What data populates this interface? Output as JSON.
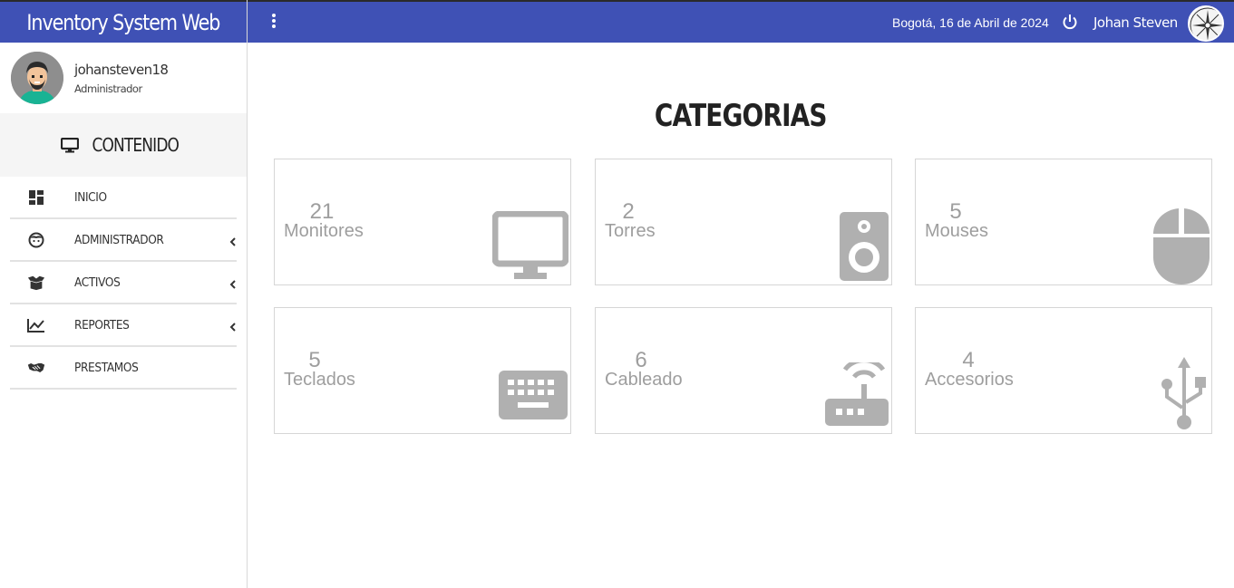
{
  "app": {
    "title": "Inventory System Web"
  },
  "topbar": {
    "date": "Bogotá, 16 de Abril de 2024",
    "user_name": "Johan Steven",
    "power_icon": "power-icon",
    "menu_icon": "kebab-menu-icon"
  },
  "sidebar": {
    "user": {
      "username": "johansteven18",
      "role": "Administrador"
    },
    "section_label": "CONTENIDO",
    "section_icon": "monitor-icon",
    "items": [
      {
        "label": "INICIO",
        "icon": "dashboard-icon",
        "has_submenu": false
      },
      {
        "label": "ADMINISTRADOR",
        "icon": "face-icon",
        "has_submenu": true
      },
      {
        "label": "ACTIVOS",
        "icon": "box-icon",
        "has_submenu": true
      },
      {
        "label": "REPORTES",
        "icon": "chart-line-icon",
        "has_submenu": true
      },
      {
        "label": "PRESTAMOS",
        "icon": "handshake-icon",
        "has_submenu": false
      }
    ]
  },
  "main": {
    "title": "CATEGORIAS",
    "cards": [
      {
        "count": "21",
        "name": "Monitores",
        "icon": "monitor-icon"
      },
      {
        "count": "2",
        "name": "Torres",
        "icon": "speaker-icon"
      },
      {
        "count": "5",
        "name": "Mouses",
        "icon": "mouse-icon"
      },
      {
        "count": "5",
        "name": "Teclados",
        "icon": "keyboard-icon"
      },
      {
        "count": "6",
        "name": "Cableado",
        "icon": "router-icon"
      },
      {
        "count": "4",
        "name": "Accesorios",
        "icon": "usb-icon"
      }
    ]
  },
  "colors": {
    "primary": "#3f51b5",
    "card_text": "#9e9e9e",
    "card_icon": "#b0b0b0",
    "section_bg": "#f5f5f5"
  }
}
